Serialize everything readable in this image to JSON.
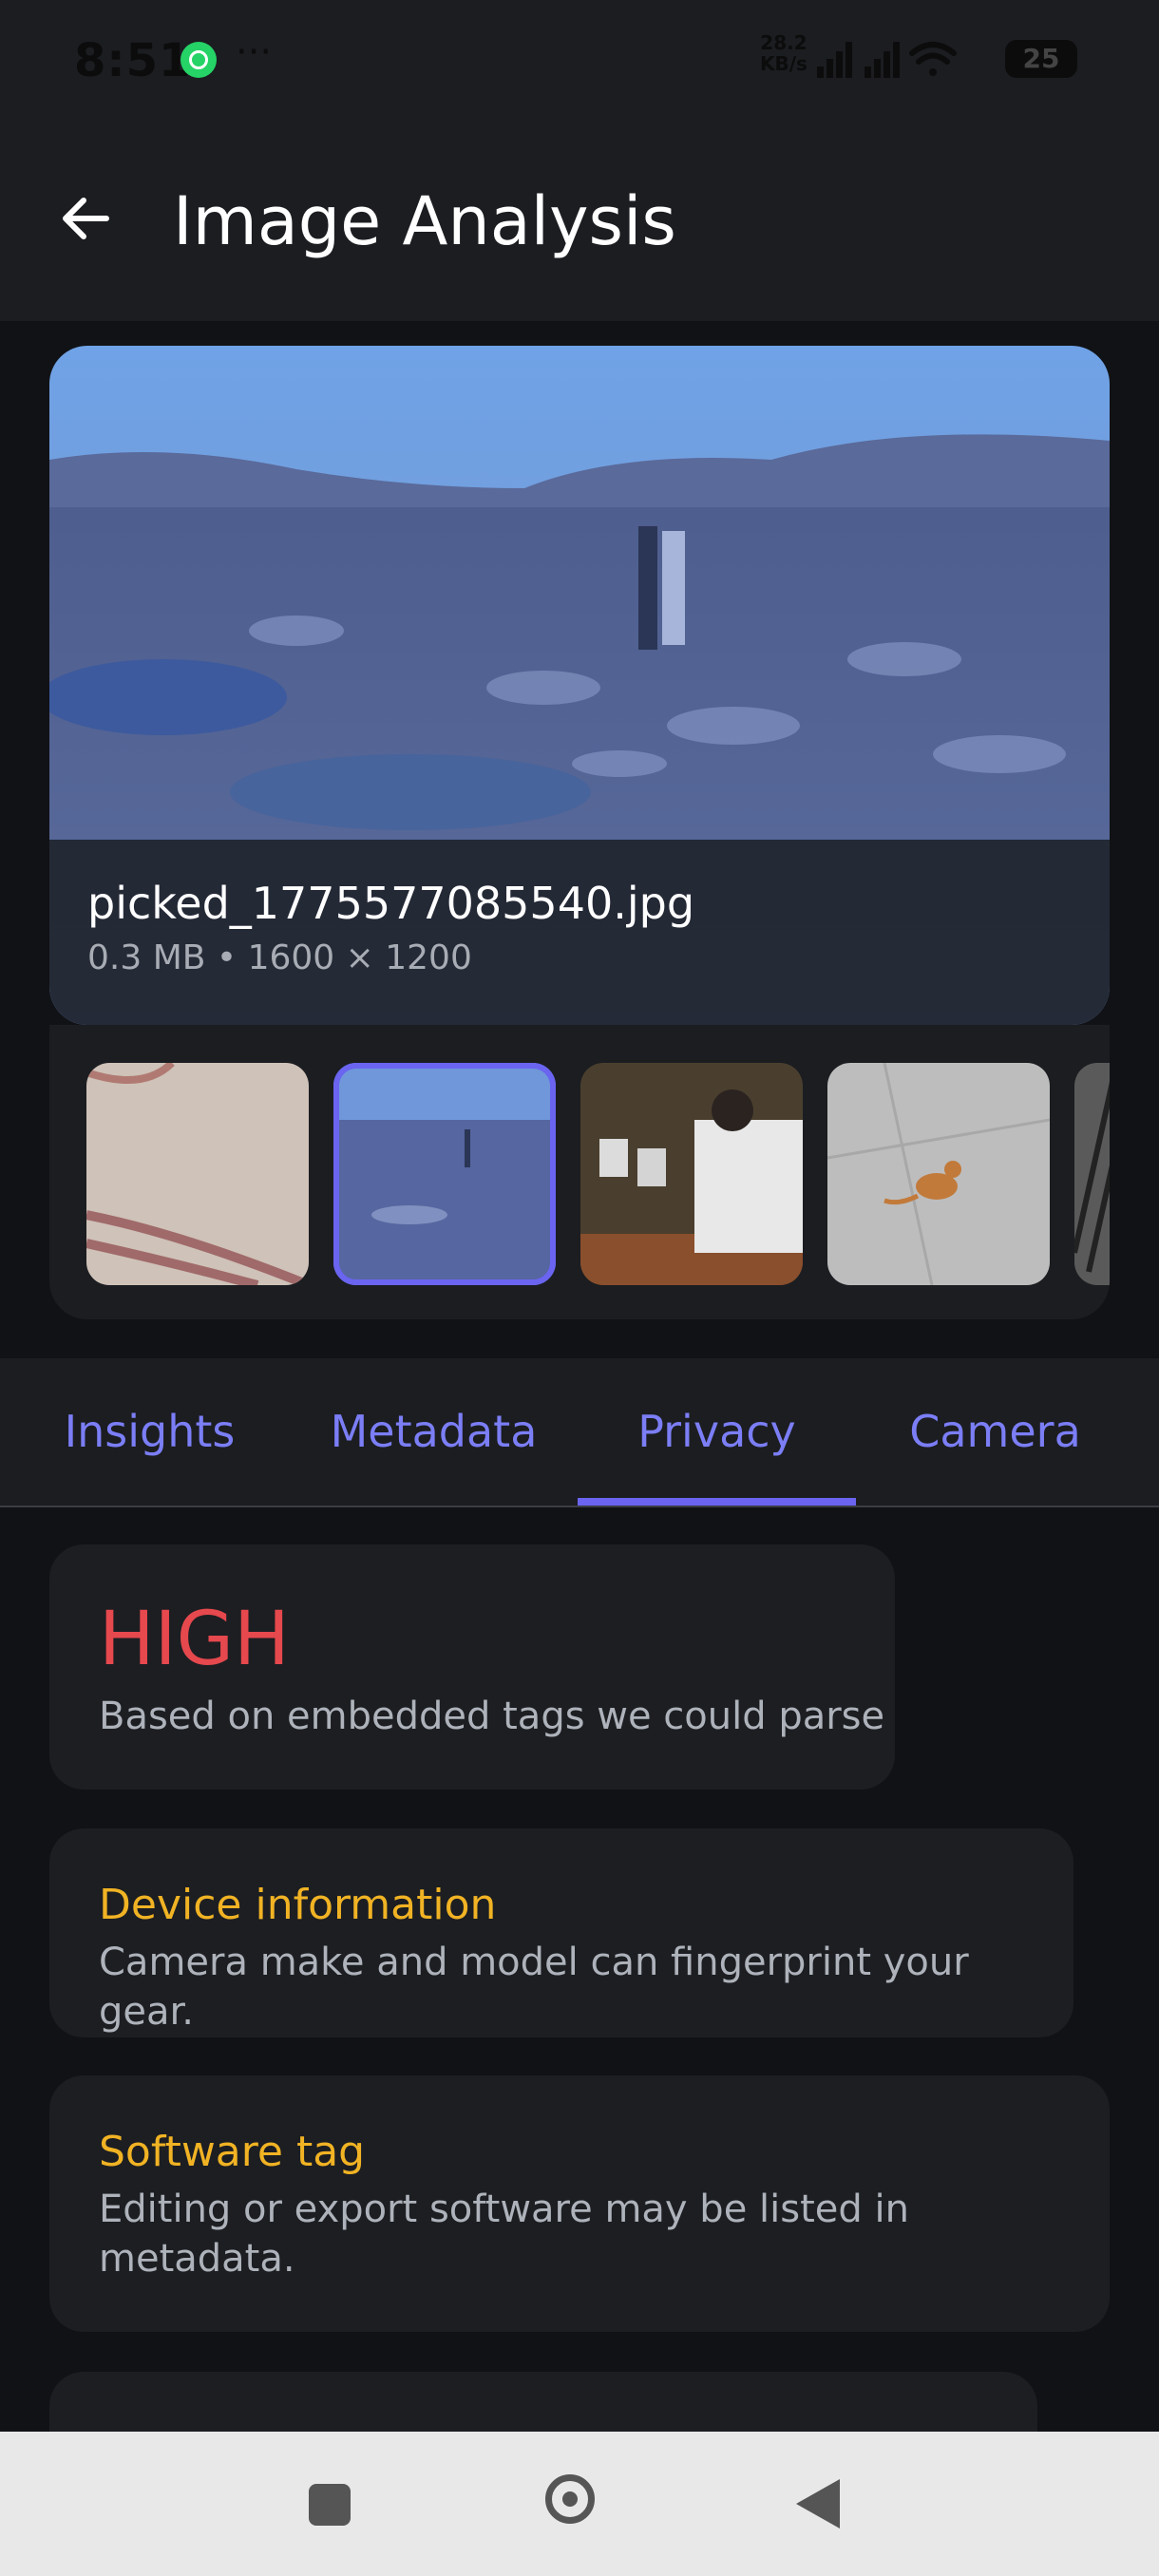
{
  "status_bar": {
    "time": "8:51",
    "more": "···",
    "speed_value": "28.2",
    "speed_unit": "KB/s",
    "battery": "25"
  },
  "header": {
    "title": "Image Analysis",
    "back_icon": "arrow-left-icon"
  },
  "image": {
    "filename": "picked_1775577085540.jpg",
    "meta": "0.3 MB  •  1600 × 1200"
  },
  "thumbnails": [
    {
      "label": "carpet-photo",
      "selected": false
    },
    {
      "label": "river-rocks-photo",
      "selected": true
    },
    {
      "label": "classroom-photo",
      "selected": false
    },
    {
      "label": "cat-on-pavement-photo",
      "selected": false
    },
    {
      "label": "partial-photo",
      "selected": false
    }
  ],
  "tabs": [
    {
      "label": "Insights"
    },
    {
      "label": "Metadata"
    },
    {
      "label": "Privacy",
      "active": true
    },
    {
      "label": "Camera"
    }
  ],
  "privacy": {
    "level": "HIGH",
    "level_desc": "Based on embedded tags we could parse",
    "items": [
      {
        "title": "Device information",
        "desc": "Camera make and model can fingerprint your gear."
      },
      {
        "title": "Software tag",
        "desc_line1": "Editing or export software may be listed in",
        "desc_line2": "metadata."
      }
    ]
  },
  "colors": {
    "accent": "#6a64f0",
    "danger": "#e5484d",
    "warning": "#f1b324",
    "surface": "#1c1e22",
    "background": "#111216"
  }
}
